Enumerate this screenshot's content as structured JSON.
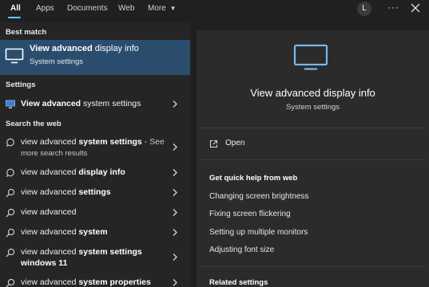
{
  "tabs": [
    {
      "label": "All",
      "active": true
    },
    {
      "label": "Apps"
    },
    {
      "label": "Documents"
    },
    {
      "label": "Web"
    },
    {
      "label": "More"
    }
  ],
  "header": {
    "avatar_letter": "L",
    "dots": "···"
  },
  "left": {
    "best_match_label": "Best match",
    "best_match": {
      "title_bold": "View advanced",
      "title_rest": " display info",
      "subtitle": "System settings",
      "icon": "monitor-icon"
    },
    "settings_label": "Settings",
    "settings_items": [
      {
        "bold": "View advanced",
        "rest": " system settings",
        "icon": "system-settings-icon"
      }
    ],
    "web_label": "Search the web",
    "web_items": [
      {
        "pre": "view advanced ",
        "bold": "system settings",
        "suffix": " - See",
        "sub": "more search results",
        "icon": "web-search-icon"
      },
      {
        "pre": "view advanced ",
        "bold": "display info",
        "icon": "web-search-icon"
      },
      {
        "pre": "view advanced ",
        "bold": "settings",
        "icon": "search-icon"
      },
      {
        "pre": "view advanced",
        "bold": "",
        "icon": "search-icon"
      },
      {
        "pre": "view advanced ",
        "bold": "system",
        "icon": "search-icon"
      },
      {
        "pre": "view advanced ",
        "bold": "system settings",
        "line2": "windows 11",
        "icon": "search-icon"
      },
      {
        "pre": "view advanced ",
        "bold": "system properties",
        "icon": "search-icon"
      }
    ]
  },
  "right": {
    "title": "View advanced display info",
    "subtitle": "System settings",
    "open_label": "Open",
    "help_heading": "Get quick help from web",
    "help_links": [
      "Changing screen brightness",
      "Fixing screen flickering",
      "Setting up multiple monitors",
      "Adjusting font size"
    ],
    "related_heading": "Related settings"
  },
  "colors": {
    "accent": "#60cdff",
    "selected_bg": "#2a4d6e"
  }
}
